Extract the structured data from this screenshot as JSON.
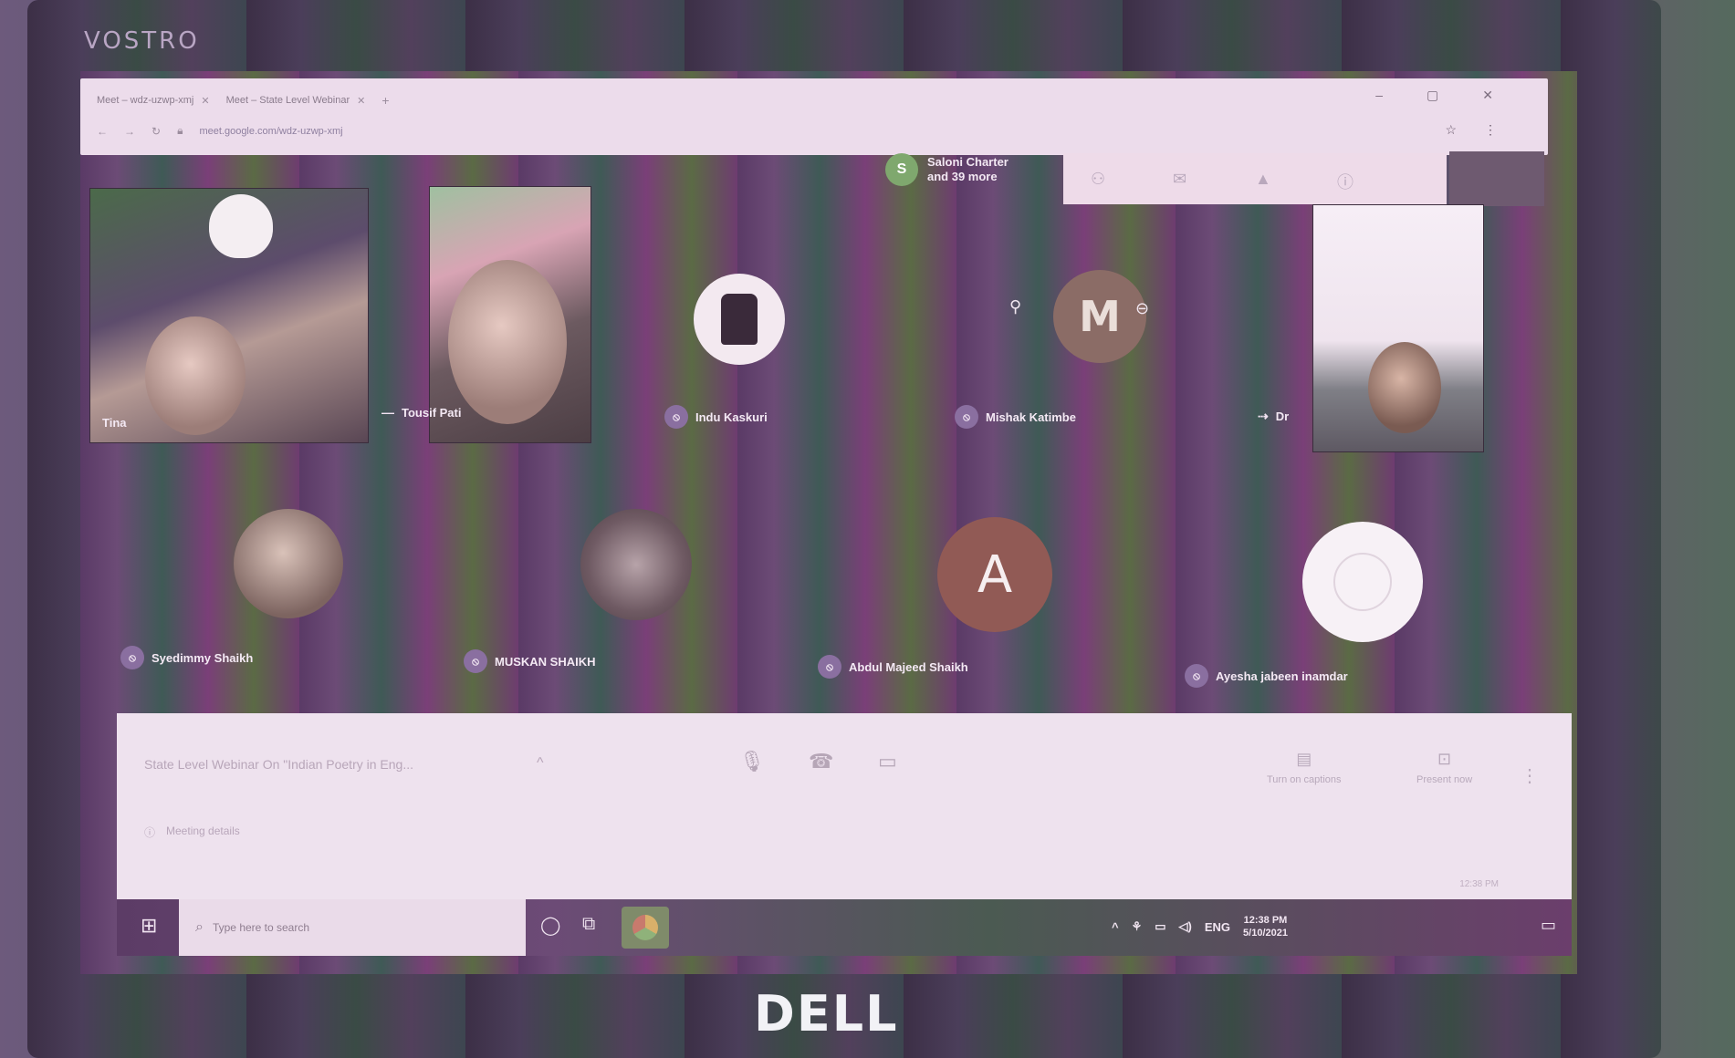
{
  "device": {
    "brand_top": "VOSTRO",
    "brand_bottom": "DELL"
  },
  "browser": {
    "tabs": [
      {
        "label": "Meet – wdz-uzwp-xmj"
      },
      {
        "label": "Meet – State Level Webinar"
      }
    ],
    "new_tab": "+",
    "address": "meet.google.com/wdz-uzwp-xmj",
    "window_controls": [
      "–",
      "▢",
      "✕"
    ],
    "toolbar_icons": [
      "☆",
      "⋮"
    ]
  },
  "meet": {
    "presenter_badge": {
      "initial": "S",
      "line1": "Saloni Charter",
      "line2": "and 39 more"
    },
    "participants": [
      {
        "name": "Tina",
        "type": "video"
      },
      {
        "name": "Tousif Pati",
        "type": "video"
      },
      {
        "name": "Indu Kaskuri",
        "type": "avatar-photo"
      },
      {
        "name": "Mishak Katimbe",
        "type": "avatar-letter",
        "initial": "M"
      },
      {
        "name": "Dr",
        "type": "video"
      },
      {
        "name": "Syedimmy Shaikh",
        "type": "avatar-photo"
      },
      {
        "name": "MUSKAN SHAIKH",
        "type": "avatar-photo"
      },
      {
        "name": "Abdul Majeed Shaikh",
        "type": "avatar-letter",
        "initial": "A"
      },
      {
        "name": "Ayesha jabeen inamdar",
        "type": "avatar-white"
      }
    ],
    "bottom_bar": {
      "meeting_title": "State Level Webinar On \"Indian Poetry in Eng...",
      "meeting_details_label": "Meeting details",
      "present_label": "Present now",
      "captions_label": "Turn on captions",
      "time": "12:38 PM"
    }
  },
  "taskbar": {
    "search_placeholder": "Type here to search",
    "tray_lang": "ENG",
    "clock_time": "12:38 PM",
    "clock_date": "5/10/2021"
  }
}
